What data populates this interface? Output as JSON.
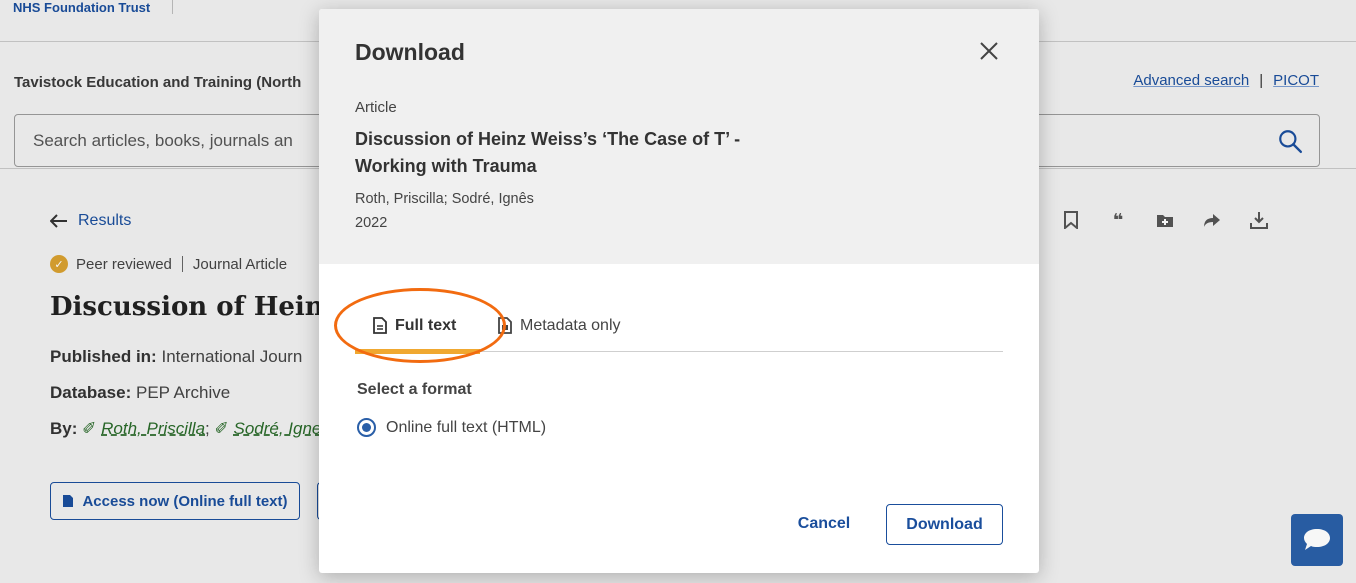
{
  "header": {
    "brand": "NHS Foundation Trust"
  },
  "search_area": {
    "institution": "Tavistock Education and Training (North",
    "advanced_search": "Advanced search",
    "picot": "PICOT",
    "placeholder": "Search articles, books, journals an"
  },
  "record": {
    "back_label": "Results",
    "peer_reviewed": "Peer reviewed",
    "doc_type": "Journal Article",
    "title": "Discussion of Heinz",
    "published_label": "Published in:",
    "published_value": "International Journ",
    "database_label": "Database:",
    "database_value": "PEP Archive",
    "by_label": "By:",
    "author1": "Roth, Priscilla",
    "author2": "Sodré, Igne",
    "access_button": "Access now (Online full text)"
  },
  "dialog": {
    "title": "Download",
    "article_type": "Article",
    "article_title": "Discussion of Heinz Weiss’s ‘The Case of T’ - Working with Trauma",
    "authors": "Roth, Priscilla; Sodré, Ignês",
    "year": "2022",
    "tabs": [
      {
        "label": "Full text",
        "active": true
      },
      {
        "label": "Metadata only",
        "active": false
      }
    ],
    "format_label": "Select a format",
    "format_option": "Online full text (HTML)",
    "cancel": "Cancel",
    "download": "Download"
  },
  "colors": {
    "link_blue": "#1a4e9c",
    "tab_underline": "#f0a830",
    "highlight": "#f26b10",
    "chat_bg": "#2a5fa8"
  }
}
